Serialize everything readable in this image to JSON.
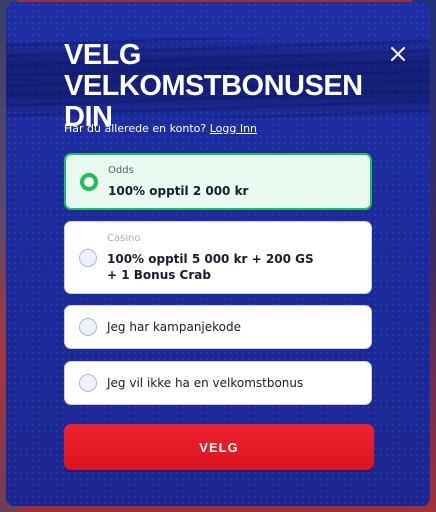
{
  "modal": {
    "title": "VELG VELKOMSTBONUSEN DIN",
    "login_prompt": "Har du allerede en konto?",
    "login_link": "Logg Inn",
    "options": [
      {
        "category": "Odds",
        "offer": "100% opptil 2 000 kr",
        "selected": true
      },
      {
        "category": "Casino",
        "offer_line1": "100% opptil 5 000 kr + 200 GS",
        "offer_line2": "+ 1 Bonus Crab",
        "selected": false
      },
      {
        "label": "Jeg har kampanjekode",
        "selected": false
      },
      {
        "label": "Jeg vil ikke ha en velkomstbonus",
        "selected": false
      }
    ],
    "cta_label": "VELG"
  },
  "colors": {
    "modal_bg": "#1d2ea4",
    "selected_accent": "#1fbf5a",
    "cta_bg": "#e8192a"
  },
  "icons": {
    "close": "close-icon"
  }
}
